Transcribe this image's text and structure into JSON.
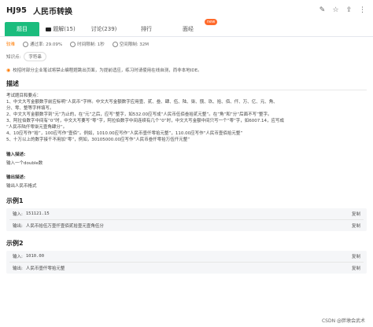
{
  "header": {
    "code": "HJ95",
    "name": "人民币转换",
    "icons": [
      "edit-icon",
      "star-icon",
      "share-icon",
      "more-icon"
    ]
  },
  "tabs": [
    {
      "label": "题目",
      "active": true
    },
    {
      "label": "题解(15)",
      "icon": "video-icon"
    },
    {
      "label": "讨论(239)"
    },
    {
      "label": "排行"
    },
    {
      "label": "面经",
      "badge": "new"
    }
  ],
  "meta": {
    "difficulty": "较难",
    "pass_rate": "通过率: 29.09%",
    "time_limit": "时间限制: 1秒",
    "space_limit": "空间限制: 32M"
  },
  "knowledge": {
    "label": "知识点:",
    "tag": "字符串"
  },
  "notice": "校招时部分企业笔试将禁止编程题跳出页面，为提前适应，练习时请使用在线自测，而非本地IDE。",
  "description": {
    "title": "描述",
    "lines": [
      "考试题目和要点：",
      "1、中文大写金额数字前应标明“人民币”字样。中文大写金额数字应用壹、贰、叁、肆、伍、陆、柒、捌、玖、拾、佰、仟、万、亿、元、角、",
      "分、零、整等字样填写。",
      "2、中文大写金额数字到“元”为止的，在“元”之后，应写“整字，如532.00应写成“人民币伍佰叁拾贰元整”。在”角“和”分“后面不写”整字。",
      "3、阿拉伯数字中间有“0”时，中文大写要写“零”字，阿拉伯数字中间连续有几个“0”时，中文大写金额中间只写一个“零”字，如6007.14，应写成",
      "“人民币陆仟零柒元壹角肆分“。",
      "4、10应写作“拾”，100应写作“壹佰”。例如，1010.00应写作“人民币壹仟零拾元整”，110.00应写作“人民币壹佰拾元整”",
      "5、十万以上的数字接千不用加“零”，例如，30105000.00应写作“人民币叁仟零拾万伍仟元整”"
    ]
  },
  "input_desc": {
    "title": "输入描述:",
    "text": "输入一个double数"
  },
  "output_desc": {
    "title": "输出描述:",
    "text": "输出人民币格式"
  },
  "examples": [
    {
      "title": "示例1",
      "input_label": "输入:",
      "input": "151121.15",
      "output_label": "输出:",
      "output": "人民币拾伍万壹仟壹佰贰拾壹元壹角伍分",
      "copy": "复制"
    },
    {
      "title": "示例2",
      "input_label": "输入:",
      "input": "1010.00",
      "output_label": "输出:",
      "output": "人民币壹仟零拾元整",
      "copy": "复制"
    }
  ],
  "watermark": "CSDN @胖墩会武术",
  "colors": {
    "accent": "#1bbc7d",
    "difficulty": "#ff7a00",
    "new_badge": "#ff6a2b"
  }
}
